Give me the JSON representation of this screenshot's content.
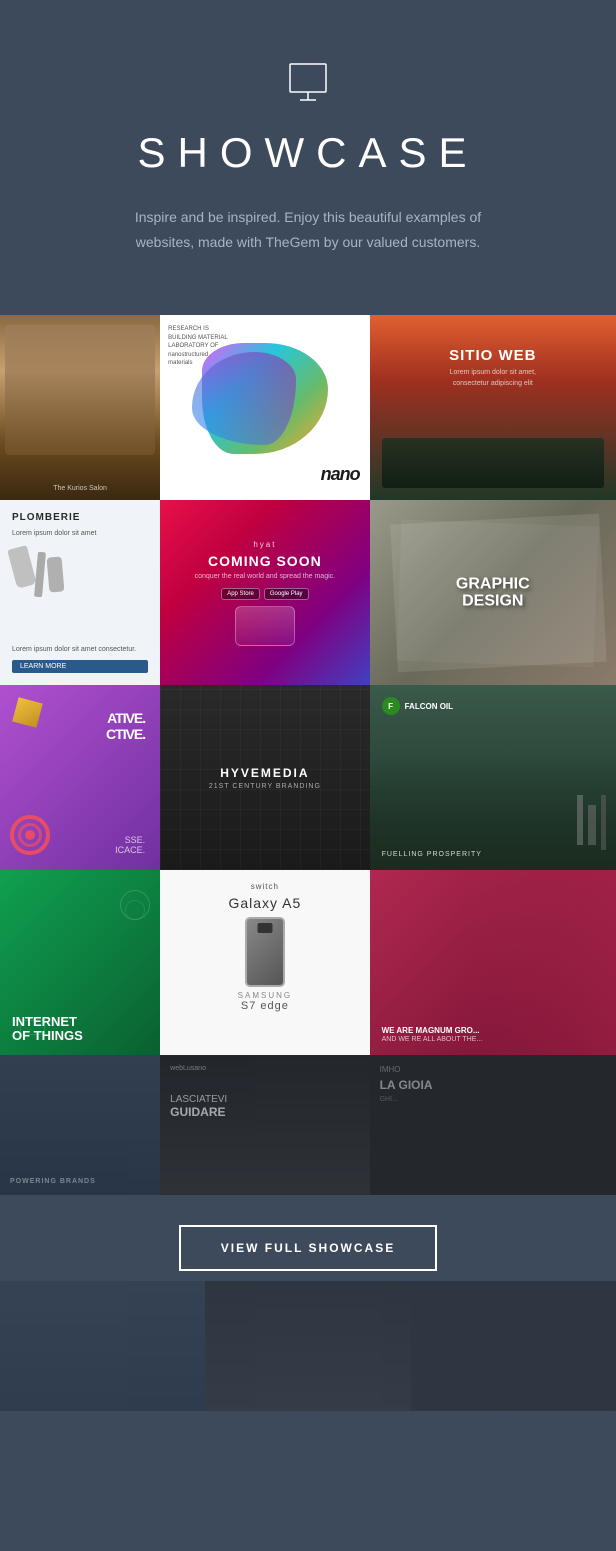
{
  "hero": {
    "title": "SHOWCASE",
    "subtitle": "Inspire and be inspired. Enjoy this beautiful examples of websites, made with TheGem by our valued customers.",
    "icon": "presentation-icon"
  },
  "grid": {
    "rows": [
      {
        "items": [
          {
            "id": "kurios",
            "alt": "The Kurios Salon"
          },
          {
            "id": "nano",
            "alt": "Nano Structured Materials"
          },
          {
            "id": "sitio",
            "alt": "Sitio Web"
          }
        ]
      },
      {
        "items": [
          {
            "id": "plomberie",
            "alt": "Plomberie"
          },
          {
            "id": "hyat",
            "alt": "Hyat Coming Soon"
          },
          {
            "id": "graphic",
            "alt": "Graphic Design"
          }
        ]
      },
      {
        "items": [
          {
            "id": "creative",
            "alt": "Creative Active"
          },
          {
            "id": "hyvemedia",
            "alt": "Hyvemedia 21st Century Branding"
          },
          {
            "id": "falcon",
            "alt": "Falcon Oil Fuelling Prosperity"
          }
        ]
      },
      {
        "items": [
          {
            "id": "iot",
            "alt": "Internet of Things"
          },
          {
            "id": "samsung",
            "alt": "Samsung Galaxy A5"
          },
          {
            "id": "magnum",
            "alt": "We Are Magnum Group"
          }
        ]
      },
      {
        "items": [
          {
            "id": "bottom1",
            "alt": "Powering Brands"
          },
          {
            "id": "bottom2",
            "alt": "Lasciatevi Guidare WebLusano"
          },
          {
            "id": "bottom3",
            "alt": "La Gioia"
          }
        ]
      }
    ]
  },
  "labels": {
    "hyvemedia_title": "HYVEMEDIA",
    "hyvemedia_sub": "21ST CENTURY BRANDING",
    "plomberie_title": "PLOMBERIE",
    "sitio_title": "SITIO WEB",
    "graphic_title": "GRAPHIC DESIGN",
    "iot_line1": "INTERNET",
    "iot_line2": "OF THINGS",
    "samsung_title": "Galaxy A5",
    "samsung_sub": "S7 edge",
    "samsung_brand": "SAMSUNG",
    "magnum_line1": "WE ARE MAGNUM GRO",
    "magnum_line2": "AND WE RE ALL ABOUT THE...",
    "falcon_line1": "FUELLING PROSPERITY",
    "creative_line1": "ATIVE.",
    "creative_line2": "CTIVE.",
    "hyat_title": "COMING SOON",
    "hyat_sub": "conquer the real world and spread the magic.",
    "bottom2_title": "LASCIATEVI",
    "bottom2_sub": "GUIDARE",
    "bottom2_brand": "webLusano",
    "bottom3_title": "LA GIOIA",
    "view_button": "VIEW FULL SHOWCASE"
  }
}
